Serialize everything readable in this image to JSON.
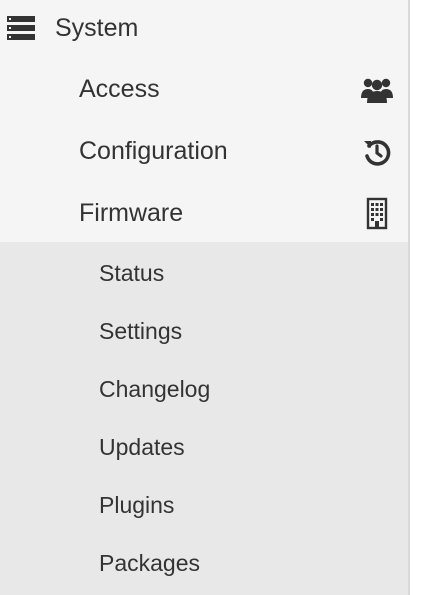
{
  "sidebar": {
    "section": {
      "label": "System",
      "icon": "server-stack-icon"
    },
    "items": [
      {
        "label": "Access",
        "icon": "users-icon"
      },
      {
        "label": "Configuration",
        "icon": "history-icon"
      },
      {
        "label": "Firmware",
        "icon": "building-icon"
      }
    ],
    "firmware_submenu": [
      {
        "label": "Status"
      },
      {
        "label": "Settings"
      },
      {
        "label": "Changelog"
      },
      {
        "label": "Updates"
      },
      {
        "label": "Plugins"
      },
      {
        "label": "Packages"
      }
    ]
  },
  "colors": {
    "sidebar_background": "#f5f5f5",
    "submenu_background": "#e8e8e8",
    "text": "#333333"
  }
}
